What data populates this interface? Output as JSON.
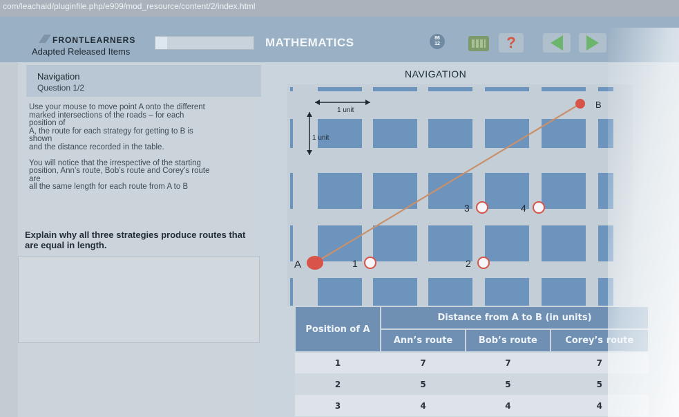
{
  "browser": {
    "url": "com/leachaid/pluginfile.php/e909/mod_resource/content/2/index.html"
  },
  "header": {
    "brand": "FRONTLEARNERS",
    "brand_sub": "Adapted Released Items",
    "subject": "MATHEMATICS",
    "counter_top": "86",
    "counter_bottom": "12",
    "help_label": "?",
    "progress": 0.12,
    "icons": [
      "calculator-icon",
      "help-icon",
      "previous-arrow-icon",
      "next-arrow-icon"
    ],
    "accent_color": "#6cb56d"
  },
  "left": {
    "nav_title": "Navigation",
    "nav_sub": "Question 1/2",
    "instructions": "Use your mouse to move point A onto the different\nmarked intersections of the roads – for each\nposition of\nA, the route for each strategy for getting to B is\nshown\nand the distance recorded in the table.\n\nYou will notice that the irrespective of the starting\nposition, Ann’s route, Bob’s route and Corey’s route\nare\nall the same length for each route from A to B",
    "question": "Explain why all three strategies produce routes that are equal in length."
  },
  "map": {
    "title": "NAVIGATION",
    "unit_label_h": "1 unit",
    "unit_label_v": "1 unit",
    "point_a": "A",
    "point_b": "B",
    "markers": [
      "1",
      "2",
      "3",
      "4"
    ],
    "point_a_color": "#d8534a",
    "block_color": "#6d94bd"
  },
  "table": {
    "col_position": "Position of A",
    "group_header": "Distance from A to B (in units)",
    "col_ann": "Ann’s route",
    "col_bob": "Bob’s route",
    "col_corey": "Corey’s route",
    "rows": [
      {
        "pos": "1",
        "ann": "7",
        "bob": "7",
        "corey": "7"
      },
      {
        "pos": "2",
        "ann": "5",
        "bob": "5",
        "corey": "5"
      },
      {
        "pos": "3",
        "ann": "4",
        "bob": "4",
        "corey": "4"
      }
    ]
  }
}
